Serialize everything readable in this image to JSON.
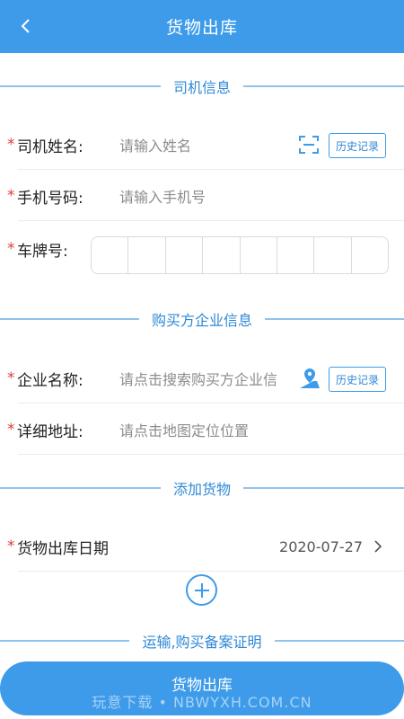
{
  "header": {
    "title": "货物出库"
  },
  "sections": {
    "driver": "司机信息",
    "buyer": "购买方企业信息",
    "goods": "添加货物",
    "proof": "运输,购买备案证明"
  },
  "driver": {
    "name_label": "司机姓名:",
    "name_placeholder": "请输入姓名",
    "history_label": "历史记录",
    "phone_label": "手机号码:",
    "phone_placeholder": "请输入手机号",
    "plate_label": "车牌号:"
  },
  "buyer": {
    "company_label": "企业名称:",
    "company_placeholder": "请点击搜索购买方企业信",
    "history_label": "历史记录",
    "address_label": "详细地址:",
    "address_placeholder": "请点击地图定位位置"
  },
  "goods": {
    "date_label": "货物出库日期",
    "date_value": "2020-07-27"
  },
  "footer": {
    "submit_label": "货物出库",
    "watermark": "玩意下载 • NBWYXH.COM.CN"
  },
  "colors": {
    "primary": "#3d9be9",
    "required": "#e23b3b"
  }
}
